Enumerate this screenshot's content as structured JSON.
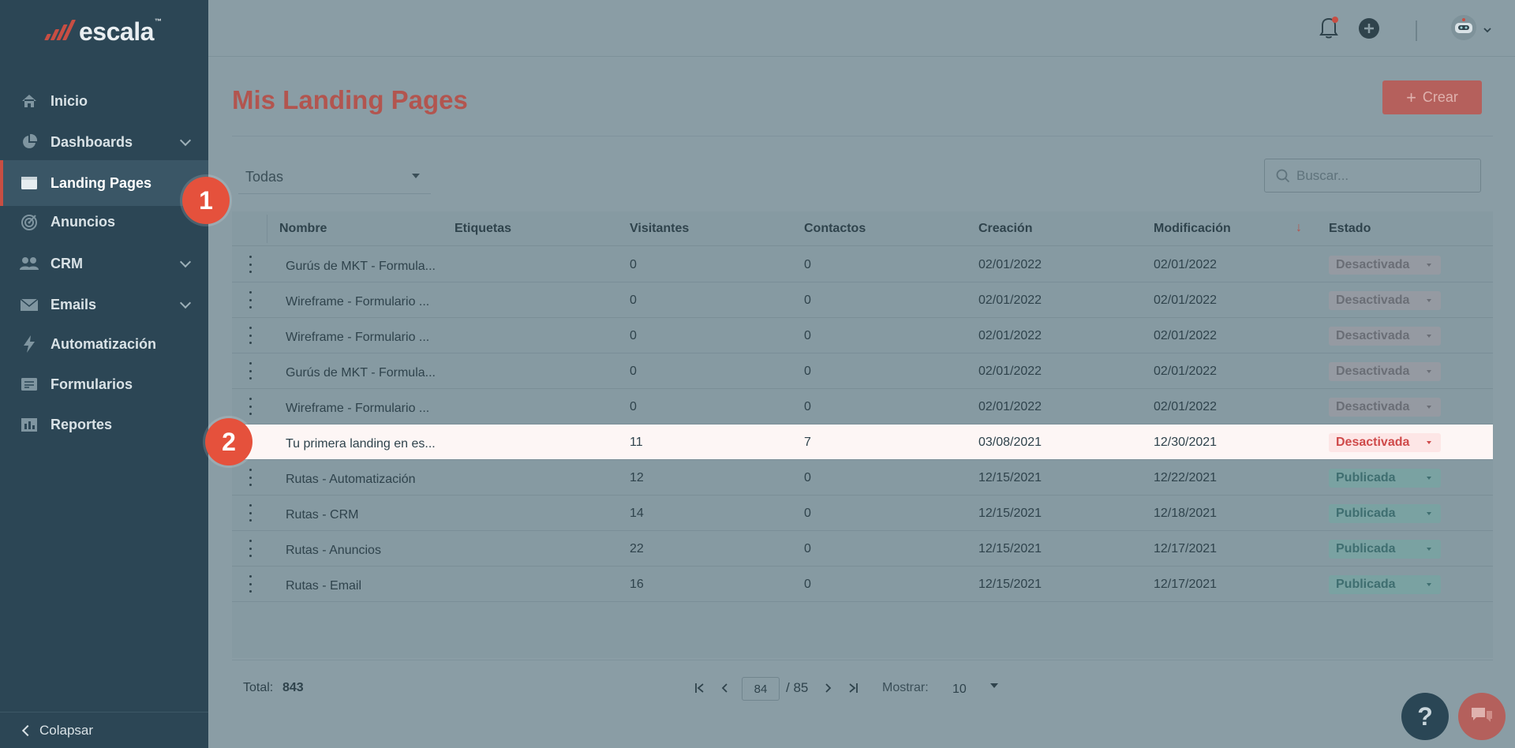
{
  "app": {
    "logo_text": "escala",
    "logo_tm": "™",
    "accent_color": "#c84e43"
  },
  "sidebar": {
    "items": [
      {
        "label": "Inicio",
        "icon": "home-icon",
        "has_chevron": false
      },
      {
        "label": "Dashboards",
        "icon": "pie-chart-icon",
        "has_chevron": true
      },
      {
        "label": "Landing Pages",
        "icon": "browser-window-icon",
        "has_chevron": false,
        "active": true
      },
      {
        "label": "Anuncios",
        "icon": "target-icon",
        "has_chevron": false
      },
      {
        "label": "CRM",
        "icon": "users-icon",
        "has_chevron": true
      },
      {
        "label": "Emails",
        "icon": "mail-icon",
        "has_chevron": true
      },
      {
        "label": "Automatización",
        "icon": "lightning-icon",
        "has_chevron": false
      },
      {
        "label": "Formularios",
        "icon": "form-icon",
        "has_chevron": false
      },
      {
        "label": "Reportes",
        "icon": "bar-chart-icon",
        "has_chevron": false
      }
    ],
    "collapse_label": "Colapsar"
  },
  "header": {
    "icons": [
      "bell-icon",
      "plus-circle-icon",
      "robot-avatar-icon",
      "chevron-down-icon"
    ]
  },
  "main": {
    "title": "Mis Landing Pages",
    "create_label": "Crear",
    "filter_value": "Todas",
    "search_placeholder": "Buscar..."
  },
  "table": {
    "columns": [
      "Nombre",
      "Etiquetas",
      "Visitantes",
      "Contactos",
      "Creación",
      "Modificación",
      "Estado"
    ],
    "sort_indicator": "↓",
    "rows": [
      {
        "name": "Gurús de MKT - Formula...",
        "tags": "",
        "visitors": "0",
        "contacts": "0",
        "created": "02/01/2022",
        "modified": "02/01/2022",
        "status": "Desactivada",
        "status_type": "off"
      },
      {
        "name": "Wireframe - Formulario ...",
        "tags": "",
        "visitors": "0",
        "contacts": "0",
        "created": "02/01/2022",
        "modified": "02/01/2022",
        "status": "Desactivada",
        "status_type": "off"
      },
      {
        "name": "Wireframe - Formulario ...",
        "tags": "",
        "visitors": "0",
        "contacts": "0",
        "created": "02/01/2022",
        "modified": "02/01/2022",
        "status": "Desactivada",
        "status_type": "off"
      },
      {
        "name": "Gurús de MKT - Formula...",
        "tags": "",
        "visitors": "0",
        "contacts": "0",
        "created": "02/01/2022",
        "modified": "02/01/2022",
        "status": "Desactivada",
        "status_type": "off"
      },
      {
        "name": "Wireframe - Formulario ...",
        "tags": "",
        "visitors": "0",
        "contacts": "0",
        "created": "02/01/2022",
        "modified": "02/01/2022",
        "status": "Desactivada",
        "status_type": "off"
      },
      {
        "name": "Tu primera landing en es...",
        "tags": "",
        "visitors": "11",
        "contacts": "7",
        "created": "03/08/2021",
        "modified": "12/30/2021",
        "status": "Desactivada",
        "status_type": "off",
        "highlight": true
      },
      {
        "name": "Rutas - Automatización",
        "tags": "",
        "visitors": "12",
        "contacts": "0",
        "created": "12/15/2021",
        "modified": "12/22/2021",
        "status": "Publicada",
        "status_type": "pub"
      },
      {
        "name": "Rutas - CRM",
        "tags": "",
        "visitors": "14",
        "contacts": "0",
        "created": "12/15/2021",
        "modified": "12/18/2021",
        "status": "Publicada",
        "status_type": "pub"
      },
      {
        "name": "Rutas - Anuncios",
        "tags": "",
        "visitors": "22",
        "contacts": "0",
        "created": "12/15/2021",
        "modified": "12/17/2021",
        "status": "Publicada",
        "status_type": "pub"
      },
      {
        "name": "Rutas - Email",
        "tags": "",
        "visitors": "16",
        "contacts": "0",
        "created": "12/15/2021",
        "modified": "12/17/2021",
        "status": "Publicada",
        "status_type": "pub"
      }
    ]
  },
  "pagination": {
    "total_label": "Total:",
    "total_value": "843",
    "current_page": "84",
    "total_pages": "/ 85",
    "show_label": "Mostrar:",
    "show_value": "10"
  },
  "badges": {
    "step1": "1",
    "step2": "2"
  },
  "help_label": "?"
}
